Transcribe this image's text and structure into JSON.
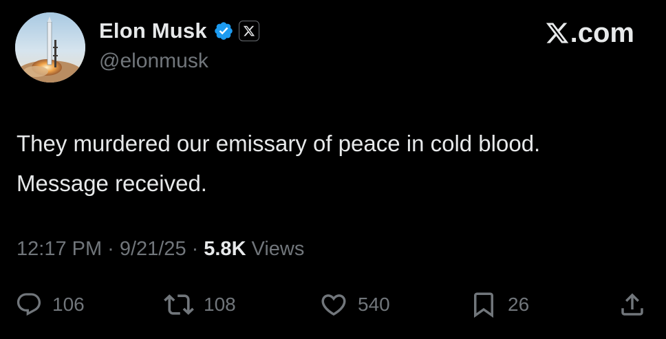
{
  "author": {
    "display_name": "Elon Musk",
    "handle": "@elonmusk",
    "verified_badge": "verified-check-icon",
    "affiliate_badge": "x-logo-icon"
  },
  "brand": {
    "site_label": ".com",
    "logo": "x-logo-icon"
  },
  "tweet": {
    "text_lines": [
      "They murdered our emissary of peace in cold blood.",
      "Message received."
    ]
  },
  "meta": {
    "time": "12:17 PM",
    "separator": "·",
    "date": "9/21/25",
    "views_count": "5.8K",
    "views_label": "Views"
  },
  "actions": {
    "reply": {
      "icon": "reply-icon",
      "count": "106"
    },
    "repost": {
      "icon": "repost-icon",
      "count": "108"
    },
    "like": {
      "icon": "heart-icon",
      "count": "540"
    },
    "bookmark": {
      "icon": "bookmark-icon",
      "count": "26"
    },
    "share": {
      "icon": "share-icon"
    }
  },
  "colors": {
    "background": "#000000",
    "primary_text": "#e7e9ea",
    "secondary_text": "#71767b",
    "verified_blue": "#1d9bf0"
  }
}
